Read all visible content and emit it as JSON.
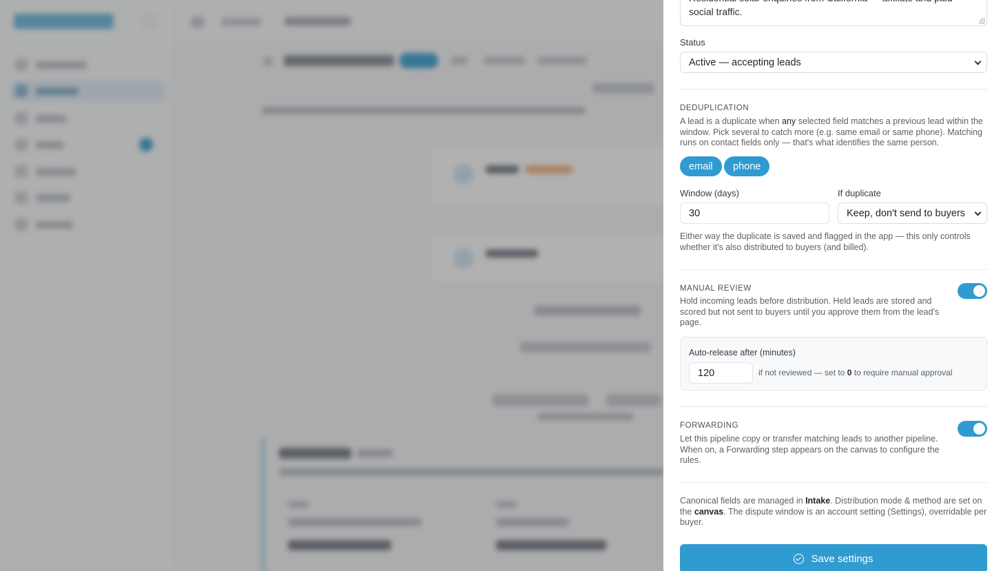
{
  "pipeline": {
    "description_value": "Residential solar enquiries from California — affiliate and paid social traffic."
  },
  "status": {
    "label": "Status",
    "selected": "Active — accepting leads"
  },
  "deduplication": {
    "title": "DEDUPLICATION",
    "desc_part1": "A lead is a duplicate when ",
    "desc_emph": "any",
    "desc_part2": " selected field matches a previous lead within the window. Pick several to catch more (e.g. same email or same phone). Matching runs on contact fields only — that's what identifies the same person.",
    "chips": [
      "email",
      "phone"
    ],
    "window_label": "Window (days)",
    "window_value": "30",
    "if_duplicate_label": "If duplicate",
    "if_duplicate_selected": "Keep, don't send to buyers",
    "note": "Either way the duplicate is saved and flagged in the app — this only controls whether it's also distributed to buyers (and billed)."
  },
  "manual_review": {
    "title": "MANUAL REVIEW",
    "desc": "Hold incoming leads before distribution. Held leads are stored and scored but not sent to buyers until you approve them from the lead's page.",
    "enabled": true,
    "auto_release_label": "Auto-release after (minutes)",
    "auto_release_value": "120",
    "hint_part1": "if not reviewed — set to ",
    "hint_emph": "0",
    "hint_part2": " to require manual approval"
  },
  "forwarding": {
    "title": "FORWARDING",
    "desc": "Let this pipeline copy or transfer matching leads to another pipeline. When on, a Forwarding step appears on the canvas to configure the rules.",
    "enabled": true
  },
  "footer_note": {
    "part1": "Canonical fields are managed in ",
    "emph1": "Intake",
    "part2": ". Distribution mode & method are set on the ",
    "emph2": "canvas",
    "part3": ". The dispute window is an account setting (Settings), overridable per buyer."
  },
  "save_button": {
    "label": "Save settings",
    "icon": "check-circle-icon"
  },
  "colors": {
    "accent": "#2f9bd0"
  }
}
